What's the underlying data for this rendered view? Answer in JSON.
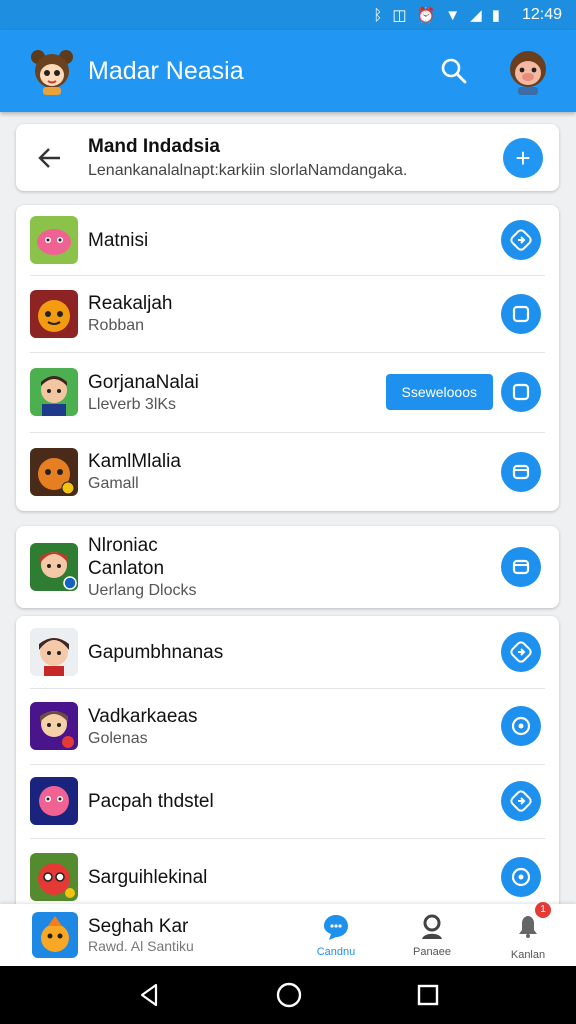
{
  "status_bar": {
    "time": "12:49"
  },
  "app_bar": {
    "title": "Madar Neasia"
  },
  "header": {
    "title": "Mand Indadsia",
    "subtitle": "Lenankanalalnapt:karkiin slorlaNamdangaka."
  },
  "group1": [
    {
      "title": "Matnisi",
      "subtitle": "",
      "chip": ""
    },
    {
      "title": "Reakaljah",
      "subtitle": "Robban",
      "chip": ""
    },
    {
      "title": "GorjanaNalai",
      "subtitle": "Lleverb 3lKs",
      "chip": "Ssewelooos"
    },
    {
      "title": "KamlMlalia",
      "subtitle": "Gamall",
      "chip": ""
    }
  ],
  "group2": [
    {
      "title_line1": "Nlroniac",
      "title_line2": "Canlaton",
      "subtitle": "Uerlang Dlocks"
    }
  ],
  "group3": [
    {
      "title": "Gapumbhnanas",
      "subtitle": ""
    },
    {
      "title": "Vadkarkaeas",
      "subtitle": "Golenas"
    },
    {
      "title": "Pacpah thdstel",
      "subtitle": ""
    },
    {
      "title": "Sarguihlekinal",
      "subtitle": ""
    }
  ],
  "bottom_nav": {
    "user_name": "Seghah Kar",
    "user_sub": "Rawd. Al Santiku",
    "items": [
      {
        "label": "Candnu",
        "icon": "chat-bubble-icon",
        "active": true
      },
      {
        "label": "Panaee",
        "icon": "person-icon",
        "active": false
      },
      {
        "label": "Kanlan",
        "icon": "bell-icon",
        "active": false,
        "badge": "1"
      }
    ]
  },
  "colors": {
    "primary": "#2196f3",
    "accent": "#1e90ee",
    "badge": "#e53935"
  }
}
